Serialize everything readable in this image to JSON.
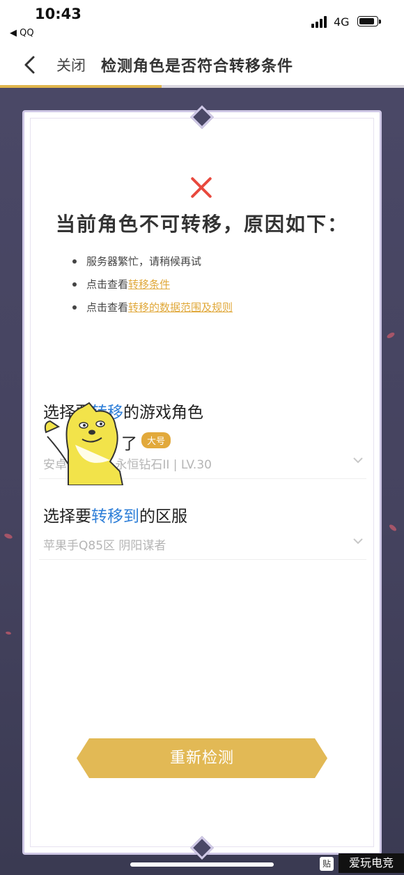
{
  "status": {
    "time": "10:43",
    "back_app": "◀ QQ",
    "network": "4G"
  },
  "nav": {
    "close_label": "关闭",
    "title": "检测角色是否符合转移条件",
    "progress_fraction": 0.4
  },
  "result": {
    "title": "当前角色不可转移，原因如下：",
    "reasons": [
      {
        "text": "服务器繁忙，请稍候再试",
        "link": ""
      },
      {
        "text": "点击查看",
        "link": "转移条件"
      },
      {
        "text": "点击查看",
        "link": "转移的数据范围及规则"
      }
    ]
  },
  "role_section": {
    "label_pre": "选择要",
    "label_hl": "转移",
    "label_post": "的游戏角色",
    "role_name": "了",
    "role_tag": "大号",
    "role_detail": "安卓手Q   区 | 永恒钻石II | LV.30"
  },
  "server_section": {
    "label_pre": "选择要",
    "label_hl": "转移到",
    "label_post": "的区服",
    "server_detail": "苹果手Q85区 阴阳谋者"
  },
  "button": {
    "label": "重新检测"
  },
  "watermark": {
    "text": "爱玩电竞",
    "small": "贴"
  },
  "colors": {
    "accent": "#e2b955",
    "error": "#e8493e",
    "highlight": "#2f7fd8",
    "link": "#e0a83a",
    "background": "#4a4866"
  }
}
